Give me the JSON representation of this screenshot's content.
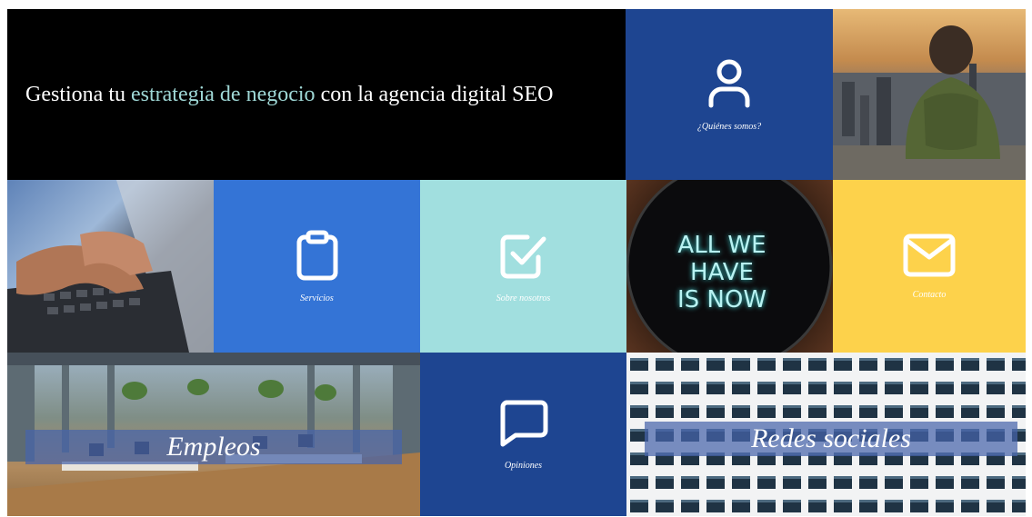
{
  "hero": {
    "title_before": "Gestiona tu ",
    "title_accent": "estrategia de negocio",
    "title_after": " con la agencia digital SEO"
  },
  "tiles": {
    "quienes": {
      "label": "¿Quiénes somos?",
      "color": "#1e4591",
      "icon": "user-icon"
    },
    "servicios": {
      "label": "Servicios",
      "color": "#3474d6",
      "icon": "clipboard-icon"
    },
    "sobre": {
      "label": "Sobre nosotros",
      "color": "#a1dfdf",
      "icon": "checkbox-icon"
    },
    "contacto": {
      "label": "Contacto",
      "color": "#fdd24b",
      "icon": "mail-icon"
    },
    "opiniones": {
      "label": "Opiniones",
      "color": "#1e4591",
      "icon": "chat-bubble-icon"
    },
    "empleos": {
      "label": "Empleos",
      "icon": "office-photo"
    },
    "redes": {
      "label": "Redes sociales",
      "icon": "building-facade-photo"
    },
    "neon": {
      "line1": "ALL WE",
      "line2": "HAVE",
      "line3": "IS NOW"
    }
  }
}
